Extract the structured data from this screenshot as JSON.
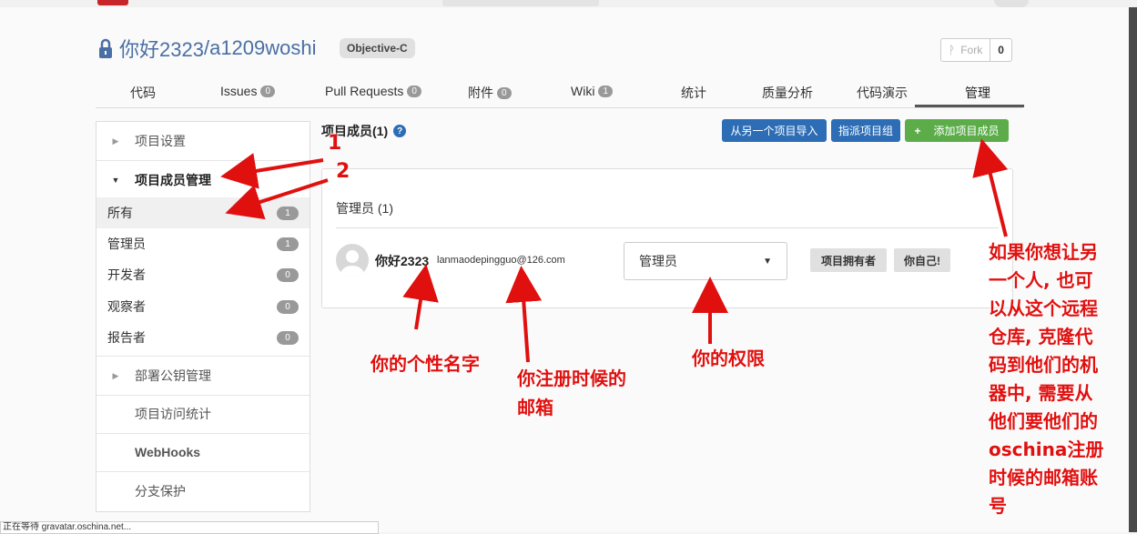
{
  "repo": {
    "owner": "你好2323",
    "separator": "/",
    "name": "a1209woshi",
    "language": "Objective-C",
    "fork_label": "Fork",
    "fork_count": "0"
  },
  "tabs": [
    {
      "label": "代码",
      "count": ""
    },
    {
      "label": "Issues",
      "count": "0"
    },
    {
      "label": "Pull Requests",
      "count": "0"
    },
    {
      "label": "附件",
      "count": "0"
    },
    {
      "label": "Wiki",
      "count": "1"
    },
    {
      "label": "统计",
      "count": ""
    },
    {
      "label": "质量分析",
      "count": ""
    },
    {
      "label": "代码演示",
      "count": ""
    },
    {
      "label": "管理",
      "count": ""
    }
  ],
  "sidebar": {
    "project_settings": "项目设置",
    "member_management": "项目成员管理",
    "subitems": [
      {
        "label": "所有",
        "count": "1"
      },
      {
        "label": "管理员",
        "count": "1"
      },
      {
        "label": "开发者",
        "count": "0"
      },
      {
        "label": "观察者",
        "count": "0"
      },
      {
        "label": "报告者",
        "count": "0"
      }
    ],
    "deploy_keys": "部署公钥管理",
    "access_stats": "项目访问统计",
    "webhooks": "WebHooks",
    "branch_protect": "分支保护"
  },
  "members": {
    "title": "项目成员(1)",
    "import_button": "从另一个项目导入",
    "assign_group_button": "指派项目组",
    "add_member_button": "添加项目成员",
    "add_icon": "+",
    "role_heading": "管理员 (1)",
    "user": {
      "name": "你好2323",
      "email": "lanmaodepingguo@126.com",
      "role": "管理员",
      "tag_owner": "项目拥有者",
      "tag_self": "你自己!"
    }
  },
  "annotations": {
    "n1": "1",
    "n2": "2",
    "nickname": "你的个性名字",
    "email_line1": "你注册时候的",
    "email_line2": "邮箱",
    "permission": "你的权限",
    "tip": [
      "如果你想让另",
      "一个人, 也可",
      "以从这个远程",
      "仓库, 克隆代",
      "码到他们的机",
      "器中, 需要从",
      "他们要他们的",
      "oschina注册",
      "时候的邮箱账",
      "号"
    ]
  },
  "statusbar": "正在等待 gravatar.oschina.net...",
  "colors": {
    "accent": "#2d6db5",
    "success": "#5cad4a",
    "annotation": "#e0100f"
  }
}
